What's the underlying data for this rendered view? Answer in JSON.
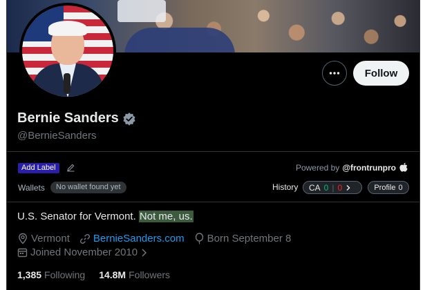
{
  "profile": {
    "name": "Bernie Sanders",
    "handle": "@BernieSanders",
    "verified": true,
    "bio_plain": "U.S. Senator for Vermont. ",
    "bio_highlight": "Not me, us.",
    "location": "Vermont",
    "website": "BernieSanders.com",
    "born": "Born September 8",
    "joined": "Joined November 2010",
    "following_count": "1,385",
    "following_label": "Following",
    "followers_count": "14.8M",
    "followers_label": "Followers"
  },
  "actions": {
    "follow_label": "Follow"
  },
  "extension": {
    "add_label": "Add Label",
    "powered_by": "Powered by",
    "brand": "@frontrunpro",
    "wallets_label": "Wallets",
    "wallet_status": "No wallet found yet",
    "history_label": "History",
    "ca_label": "CA",
    "ca_green": "0",
    "ca_red": "0",
    "profile_label": "Profile",
    "profile_count": "0"
  },
  "colors": {
    "background": "#000000",
    "accent_link": "#1d9bf0",
    "verified": "#8b98a5",
    "label_chip": "#2a1fa8",
    "positive": "#00ba7c",
    "negative": "#f4212e",
    "highlight": "#3c5b3e"
  },
  "icons": {
    "more": "more-horizontal-icon",
    "verified": "verified-badge-icon",
    "edit": "pencil-icon",
    "brand": "apple-logo-icon",
    "location": "location-pin-icon",
    "link": "link-icon",
    "birthday": "balloon-icon",
    "calendar": "calendar-icon"
  }
}
